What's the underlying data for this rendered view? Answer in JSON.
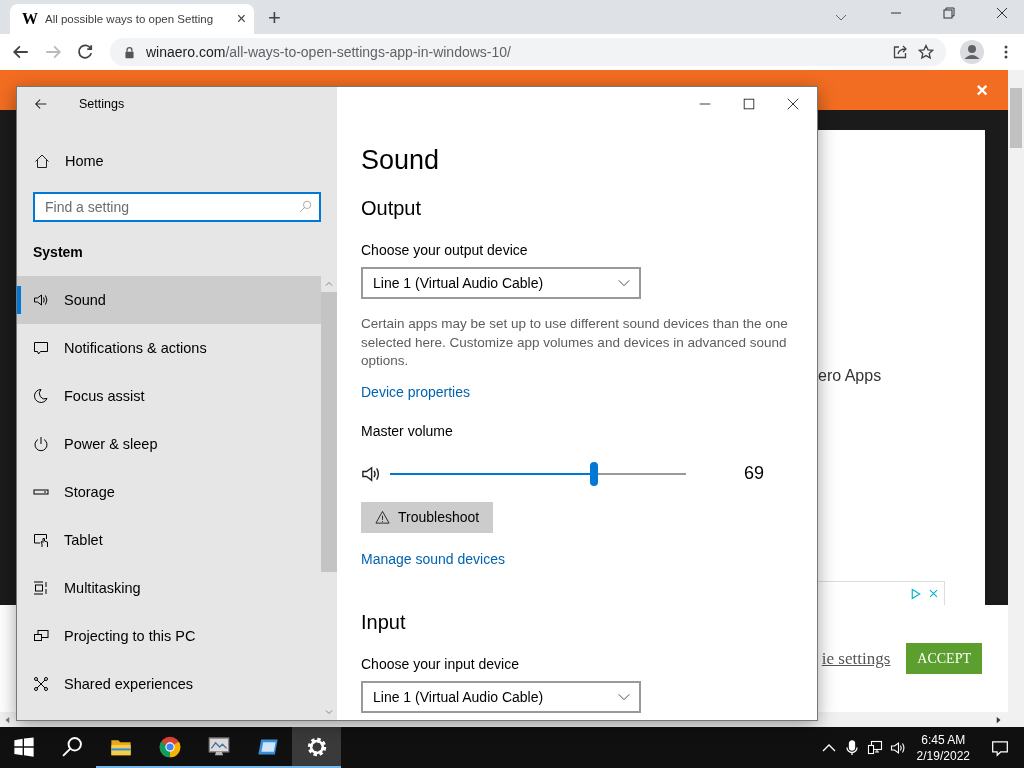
{
  "browser": {
    "tab": {
      "favicon": "W",
      "title": "All possible ways to open Setting",
      "close": "×"
    },
    "new_tab": "+",
    "nav_buttons": [
      {
        "kind": "back",
        "disabled": false
      },
      {
        "kind": "forward",
        "disabled": true
      },
      {
        "kind": "reload",
        "disabled": false
      }
    ],
    "address": {
      "host": "winaero.com",
      "path": "/all-ways-to-open-settings-app-in-windows-10/"
    }
  },
  "page": {
    "banner_close": "×",
    "card_text": "ero Apps",
    "cookie_link": "ie settings",
    "accept_button": "ACCEPT"
  },
  "settings": {
    "title": "Settings",
    "home": "Home",
    "search": {
      "placeholder": "Find a setting"
    },
    "section": "System",
    "nav": [
      {
        "label": "Sound",
        "kind": "sound",
        "selected": true
      },
      {
        "label": "Notifications & actions",
        "kind": "notifications",
        "selected": false
      },
      {
        "label": "Focus assist",
        "kind": "focus",
        "selected": false
      },
      {
        "label": "Power & sleep",
        "kind": "power",
        "selected": false
      },
      {
        "label": "Storage",
        "kind": "storage",
        "selected": false
      },
      {
        "label": "Tablet",
        "kind": "tablet",
        "selected": false
      },
      {
        "label": "Multitasking",
        "kind": "multitasking",
        "selected": false
      },
      {
        "label": "Projecting to this PC",
        "kind": "projecting",
        "selected": false
      },
      {
        "label": "Shared experiences",
        "kind": "shared",
        "selected": false
      }
    ],
    "heading": "Sound",
    "output": {
      "title": "Output",
      "label": "Choose your output device",
      "device": "Line 1 (Virtual Audio Cable)",
      "note": "Certain apps may be set up to use different sound devices than the one selected here. Customize app volumes and devices in advanced sound options.",
      "link": "Device properties",
      "volume_label": "Master volume",
      "volume": {
        "level": 0.69,
        "reading": "69"
      },
      "troubleshoot": "Troubleshoot",
      "manage_link": "Manage sound devices"
    },
    "input": {
      "title": "Input",
      "label": "Choose your input device",
      "device": "Line 1 (Virtual Audio Cable)"
    }
  },
  "taskbar": {
    "apps": [
      {
        "kind": "start",
        "running": false,
        "selected": false
      },
      {
        "kind": "search",
        "running": false,
        "selected": false
      },
      {
        "kind": "folder",
        "running": true,
        "selected": false
      },
      {
        "kind": "browser",
        "running": true,
        "selected": false
      },
      {
        "kind": "monitor",
        "running": true,
        "selected": false
      },
      {
        "kind": "window",
        "running": true,
        "selected": false
      },
      {
        "kind": "settings",
        "running": true,
        "selected": true
      }
    ],
    "time": "6:45 AM",
    "date": "2/19/2022"
  }
}
